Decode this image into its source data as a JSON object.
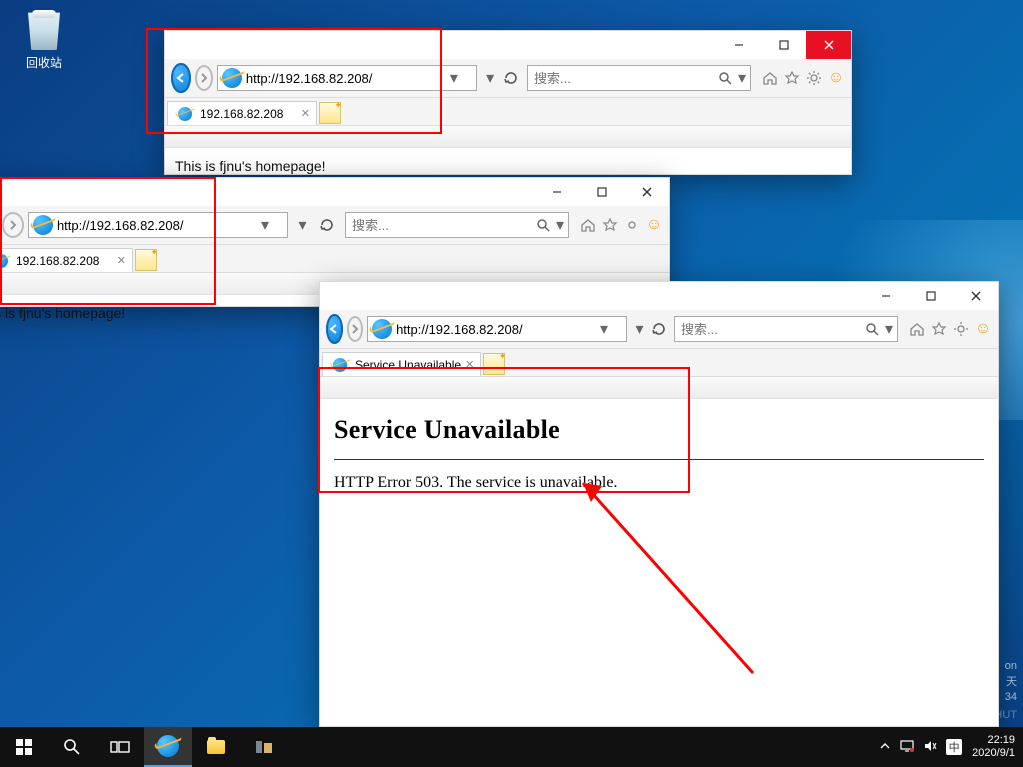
{
  "desktop": {
    "recycle_bin_label": "回收站"
  },
  "win1": {
    "url": "http://192.168.82.208/",
    "search_placeholder": "搜索...",
    "tab_title": "192.168.82.208",
    "body": "This is fjnu's homepage!"
  },
  "win2": {
    "url": "http://192.168.82.208/",
    "search_placeholder": "搜索...",
    "tab_title": "192.168.82.208",
    "body": "is is fjnu's homepage!"
  },
  "win3": {
    "url": "http://192.168.82.208/",
    "search_placeholder": "搜索...",
    "tab_title": "Service Unavailable",
    "error_title": "Service Unavailable",
    "error_body": "HTTP Error 503. The service is unavailable."
  },
  "tray": {
    "time": "22:19",
    "date": "2020/9/1",
    "ime_zh": "中"
  },
  "watermark": {
    "line1": "on",
    "line2": "天",
    "line3": "34",
    "line4": "CSDN @NOWSHUT"
  }
}
